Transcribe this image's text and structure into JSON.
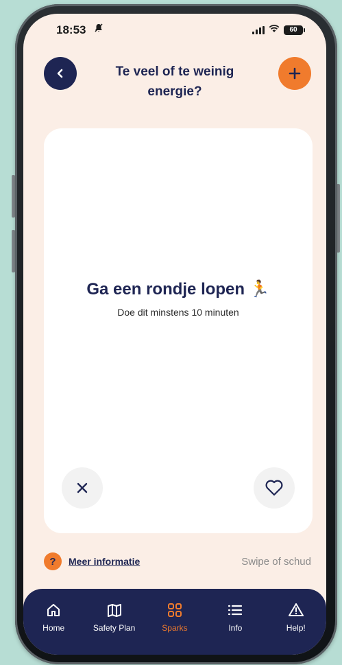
{
  "status_bar": {
    "time": "18:53",
    "battery": "60",
    "icons": [
      "silent-bell-icon",
      "signal-icon",
      "wifi-icon",
      "battery-icon"
    ]
  },
  "header": {
    "title": "Te veel of te weinig energie?",
    "back_icon": "chevron-left-icon",
    "add_icon": "plus-icon"
  },
  "card": {
    "title": "Ga een rondje lopen 🏃",
    "subtitle": "Doe dit minstens 10 minuten",
    "dismiss_icon": "close-icon",
    "like_icon": "heart-icon"
  },
  "info": {
    "icon_glyph": "?",
    "link_label": "Meer informatie",
    "swipe_hint": "Swipe of schud"
  },
  "tabs": [
    {
      "label": "Home",
      "icon": "home-icon",
      "active": false
    },
    {
      "label": "Safety Plan",
      "icon": "map-icon",
      "active": false
    },
    {
      "label": "Sparks",
      "icon": "grid-icon",
      "active": true
    },
    {
      "label": "Info",
      "icon": "list-icon",
      "active": false
    },
    {
      "label": "Help!",
      "icon": "warning-icon",
      "active": false
    }
  ],
  "colors": {
    "background": "#b7ddd4",
    "screen": "#fbeee6",
    "navy": "#1e2553",
    "accent": "#f07b2d",
    "card": "#ffffff"
  }
}
